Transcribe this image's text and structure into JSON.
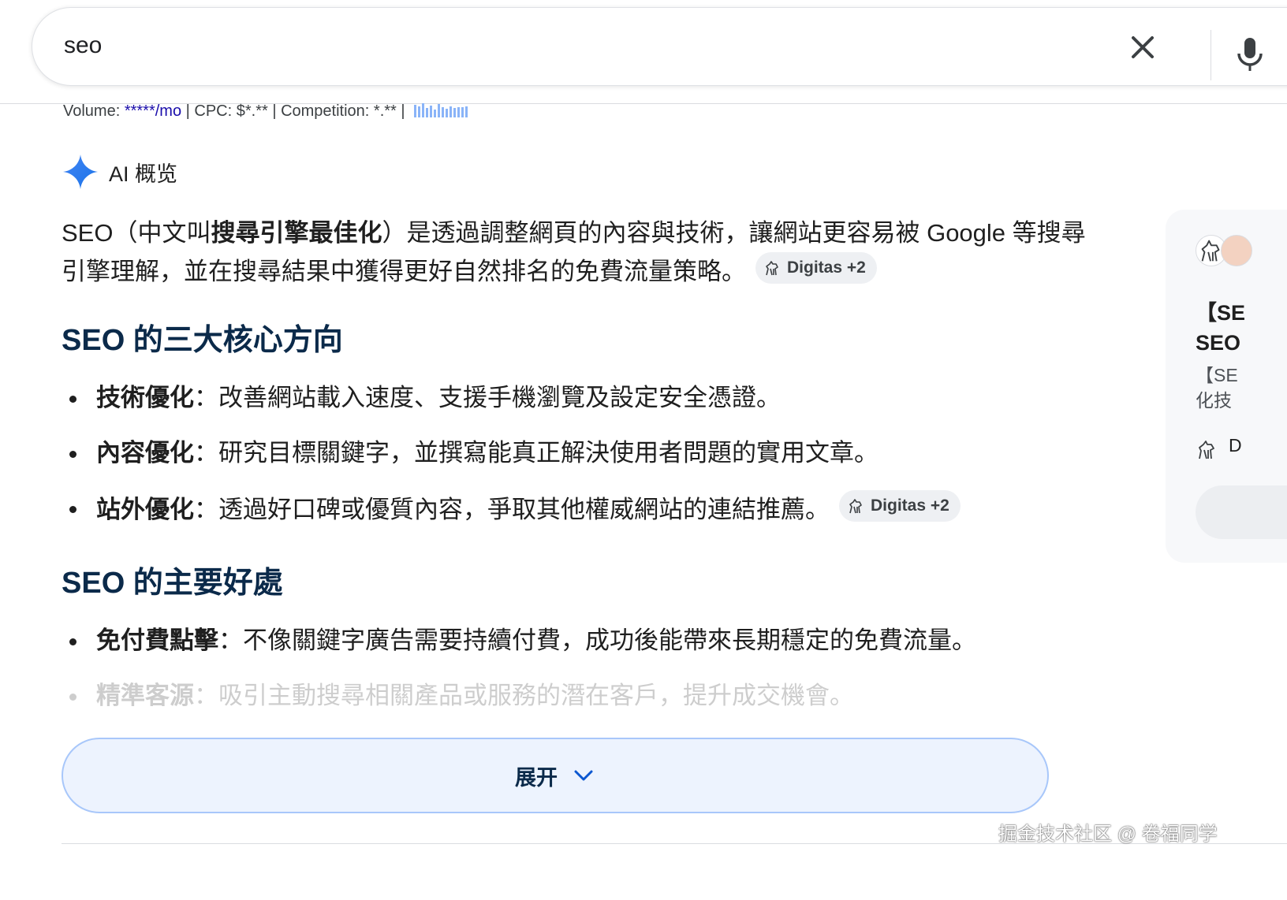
{
  "search": {
    "query": "seo",
    "clear_icon": "close-icon",
    "mic_icon": "microphone-icon",
    "lens_icon": "camera-lens-icon"
  },
  "keyword_stats": {
    "volume_label": "Volume: ",
    "volume_value": "*****/mo",
    "cpc": " | CPC: $*.** | Competition: *.** | "
  },
  "ai_overview": {
    "icon": "sparkle-icon",
    "title": "AI 概览",
    "accent_color": "#1a73e8"
  },
  "intro": {
    "prefix": "SEO（中文叫",
    "bold": "搜尋引擎最佳化",
    "suffix": "）是透過調整網頁的內容與技術，讓網站更容易被 Google 等搜尋引擎理解，並在搜尋結果中獲得更好自然排名的免費流量策略。",
    "chip": "Digitas +2"
  },
  "section1": {
    "title": "SEO 的三大核心方向",
    "items": [
      {
        "term": "技術優化",
        "sep": "：",
        "desc": "改善網站載入速度、支援手機瀏覽及設定安全憑證。"
      },
      {
        "term": "內容優化",
        "sep": "：",
        "desc": "研究目標關鍵字，並撰寫能真正解決使用者問題的實用文章。"
      },
      {
        "term": "站外優化",
        "sep": "：",
        "desc": "透過好口碑或優質內容，爭取其他權威網站的連結推薦。",
        "chip": "Digitas +2"
      }
    ]
  },
  "section2": {
    "title": "SEO 的主要好處",
    "items": [
      {
        "term": "免付費點擊",
        "sep": "：",
        "desc": "不像關鍵字廣告需要持續付費，成功後能帶來長期穩定的免費流量。"
      },
      {
        "term": "精準客源",
        "sep": "：",
        "desc": "吸引主動搜尋相關產品或服務的潛在客戶，提升成交機會。"
      }
    ]
  },
  "expand": {
    "label": "展开",
    "icon": "chevron-down-icon"
  },
  "source_card": {
    "title_line1": "【SE",
    "title_line2": "SEO",
    "snippet_line1": "【SE",
    "snippet_line2": "化技",
    "footer": "D"
  },
  "watermark": "掘金技术社区 @ 卷福同学"
}
